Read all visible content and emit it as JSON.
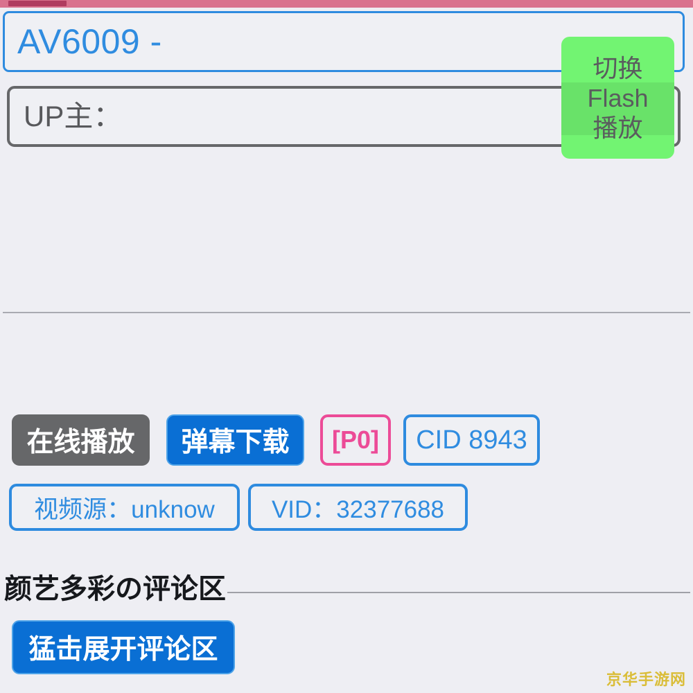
{
  "top_bar": {
    "background_color": "#d9728e",
    "segment_color": "#b03c60"
  },
  "video_info": {
    "title": "AV6009 -",
    "uploader_label": "UP主："
  },
  "flash_toggle": {
    "line1": "切换",
    "line2": "Flash",
    "line3": "播放",
    "background_color": "#72f472"
  },
  "actions": {
    "online_play": "在线播放",
    "danmaku_download": "弹幕下载",
    "part_index": "[P0]",
    "cid": "CID 8943"
  },
  "details": {
    "video_source": "视频源：unknow",
    "vid": "VID：32377688"
  },
  "comments": {
    "heading": "颜艺多彩の评论区",
    "expand_button": "猛击展开评论区"
  },
  "watermark": {
    "text": "京华手游网",
    "color": "#d9bb2f"
  }
}
